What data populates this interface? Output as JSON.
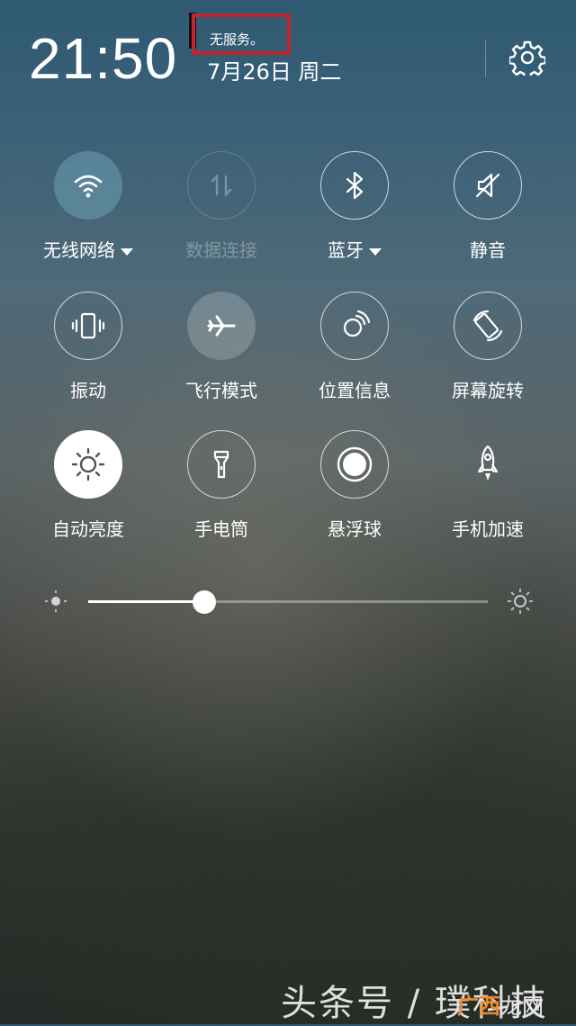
{
  "header": {
    "time": "21:50",
    "status_tag": "无服务。",
    "date": "7月26日 周二",
    "status_tag_highlight_color": "#c0262a"
  },
  "settings_icon": "gear-icon",
  "tiles": [
    {
      "label": "无线网络",
      "icon": "wifi-icon",
      "state": "on",
      "has_dropdown": true
    },
    {
      "label": "数据连接",
      "icon": "data-arrows-icon",
      "state": "disabled",
      "has_dropdown": false
    },
    {
      "label": "蓝牙",
      "icon": "bluetooth-icon",
      "state": "off",
      "has_dropdown": true
    },
    {
      "label": "静音",
      "icon": "mute-icon",
      "state": "off",
      "has_dropdown": false
    },
    {
      "label": "振动",
      "icon": "vibrate-icon",
      "state": "off",
      "has_dropdown": false
    },
    {
      "label": "飞行模式",
      "icon": "airplane-icon",
      "state": "on-grey",
      "has_dropdown": false
    },
    {
      "label": "位置信息",
      "icon": "location-icon",
      "state": "off",
      "has_dropdown": false
    },
    {
      "label": "屏幕旋转",
      "icon": "rotate-icon",
      "state": "off",
      "has_dropdown": false
    },
    {
      "label": "自动亮度",
      "icon": "sun-icon",
      "state": "on-white",
      "has_dropdown": false
    },
    {
      "label": "手电筒",
      "icon": "flashlight-icon",
      "state": "off",
      "has_dropdown": false
    },
    {
      "label": "悬浮球",
      "icon": "floating-ball-icon",
      "state": "off",
      "has_dropdown": false
    },
    {
      "label": "手机加速",
      "icon": "rocket-icon",
      "state": "plain",
      "has_dropdown": false
    }
  ],
  "brightness": {
    "level": 0.29,
    "min_icon": "sun-small-icon",
    "max_icon": "sun-large-icon"
  },
  "watermark": {
    "text": "头条号 / 璞科技",
    "logo_part1": "广西",
    "logo_part2": "龙网"
  },
  "colors": {
    "accent_teal": "#78aabe",
    "highlight_red": "#c0262a",
    "logo_orange": "#f08a2a"
  }
}
